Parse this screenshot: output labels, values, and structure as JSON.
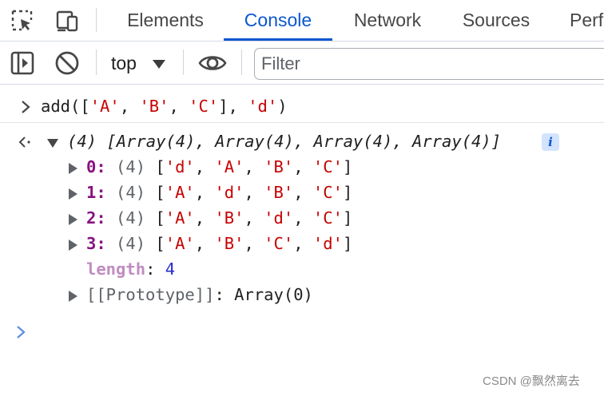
{
  "tabs": {
    "items": [
      {
        "label": "Elements",
        "active": false
      },
      {
        "label": "Console",
        "active": true
      },
      {
        "label": "Network",
        "active": false
      },
      {
        "label": "Sources",
        "active": false
      },
      {
        "label": "Perf",
        "active": false
      }
    ],
    "icons": [
      "inspect-element-icon",
      "device-toggle-icon"
    ]
  },
  "toolbar": {
    "icons": [
      "sidebar-toggle-icon",
      "clear-console-icon",
      "eye-icon"
    ],
    "context": "top",
    "filter_placeholder": "Filter"
  },
  "console": {
    "input": {
      "fn": "add",
      "open": "([",
      "args": [
        "'A'",
        "'B'",
        "'C'"
      ],
      "close": "], ",
      "extra": "'d'",
      "end": ")"
    },
    "result": {
      "summary": "(4) [Array(4), Array(4), Array(4), Array(4)]",
      "info_badge": "i",
      "rows": [
        {
          "index": "0",
          "len": "(4)",
          "items": [
            "'d'",
            "'A'",
            "'B'",
            "'C'"
          ]
        },
        {
          "index": "1",
          "len": "(4)",
          "items": [
            "'A'",
            "'d'",
            "'B'",
            "'C'"
          ]
        },
        {
          "index": "2",
          "len": "(4)",
          "items": [
            "'A'",
            "'B'",
            "'d'",
            "'C'"
          ]
        },
        {
          "index": "3",
          "len": "(4)",
          "items": [
            "'A'",
            "'B'",
            "'C'",
            "'d'"
          ]
        }
      ],
      "length_key": "length",
      "length_value": "4",
      "prototype_key": "[[Prototype]]",
      "prototype_value": "Array(0)"
    }
  },
  "watermark": "CSDN @飘然离去",
  "colors": {
    "accent": "#0b57d0",
    "string": "#c80000",
    "number": "#2a2ad0",
    "key": "#881280",
    "prompt": "#5b8fe0"
  }
}
